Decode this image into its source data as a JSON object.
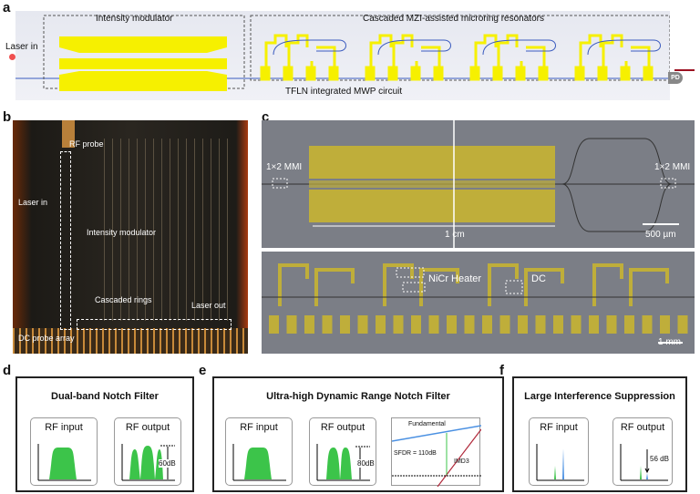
{
  "panels": {
    "a": "a",
    "b": "b",
    "c": "c",
    "d": "d",
    "e": "e",
    "f": "f"
  },
  "a": {
    "intensity_modulator": "Intensity modulator",
    "cascaded": "Cascaded MZI-assisted microring resonators",
    "laser_in": "Laser in",
    "pd": "PD",
    "circuit": "TFLN integrated MWP circuit"
  },
  "b": {
    "rf_probe": "RF probe",
    "laser_in": "Laser in",
    "intensity_modulator": "Intensity modulator",
    "cascaded_rings": "Cascaded rings",
    "laser_out": "Laser out",
    "dc_probe": "DC probe array"
  },
  "c": {
    "mmi_left": "1×2 MMI",
    "mmi_right": "1×2 MMI",
    "length": "1 cm",
    "scale_top": "500 µm",
    "heater": "NiCr Heater",
    "dc": "DC",
    "scale_bottom": "1 mm"
  },
  "d": {
    "title": "Dual-band Notch Filter",
    "input": "RF input",
    "output": "RF output",
    "depth": "60dB"
  },
  "e": {
    "title": "Ultra-high Dynamic Range Notch Filter",
    "input": "RF input",
    "output": "RF output",
    "depth": "80dB",
    "fundamental": "Fundamental",
    "sfdr": "SFDR = 110dB",
    "imd3": "IMD3"
  },
  "f": {
    "title": "Large Interference Suppression",
    "input": "RF input",
    "output": "RF output",
    "suppression": "56 dB"
  },
  "colors": {
    "gold": "#f6f000",
    "green": "#3cc44a",
    "blue": "#4a90e2",
    "red": "#b0283a"
  }
}
